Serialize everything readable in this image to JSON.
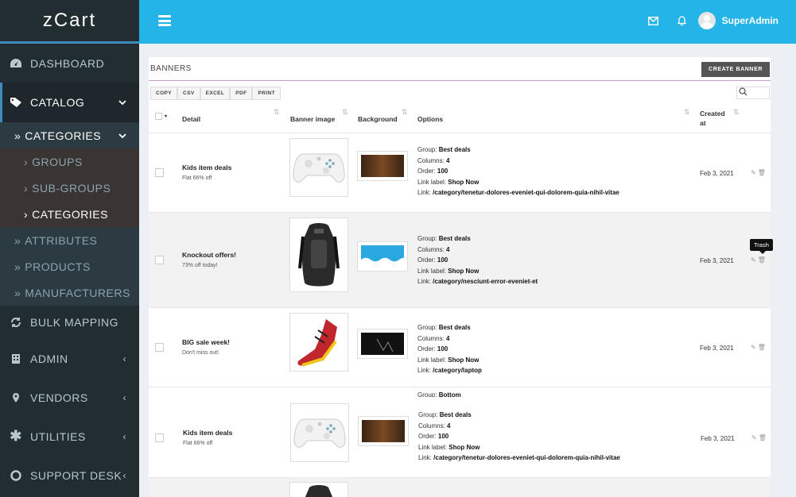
{
  "app": {
    "logo": "zCart"
  },
  "sidebar": {
    "items": [
      {
        "label": "DASHBOARD",
        "icon": "dashboard-icon"
      },
      {
        "label": "CATALOG",
        "icon": "tag-icon",
        "caret": "⌄"
      },
      {
        "label": "CATEGORIES",
        "caret": "⌄"
      },
      {
        "label": "GROUPS"
      },
      {
        "label": "SUB-GROUPS"
      },
      {
        "label": "CATEGORIES"
      },
      {
        "label": "ATTRIBUTES"
      },
      {
        "label": "PRODUCTS"
      },
      {
        "label": "MANUFACTURERS"
      },
      {
        "label": "BULK MAPPING",
        "icon": "refresh-icon"
      },
      {
        "label": "ADMIN",
        "icon": "building-icon",
        "caret": "‹"
      },
      {
        "label": "VENDORS",
        "icon": "map-pin-icon",
        "caret": "‹"
      },
      {
        "label": "UTILITIES",
        "icon": "asterisk-icon",
        "caret": "‹"
      },
      {
        "label": "SUPPORT DESK",
        "icon": "lifebuoy-icon",
        "caret": "‹"
      }
    ]
  },
  "header": {
    "user_name": "SuperAdmin"
  },
  "panel": {
    "title": "BANNERS",
    "create_label": "CREATE BANNER",
    "tools": [
      "COPY",
      "CSV",
      "EXCEL",
      "PDF",
      "PRINT"
    ],
    "columns": {
      "detail": "Detail",
      "banner_image": "Banner image",
      "background": "Background",
      "options": "Options",
      "created_1": "Created",
      "created_2": "at"
    }
  },
  "rows": [
    {
      "title": "Kids item deals",
      "subtitle": "Flat 66% off",
      "group": "Best deals",
      "columns": "4",
      "order": "100",
      "link_label": "Shop Now",
      "link": "/category/tenetur-dolores-eveniet-qui-dolorem-quia-nihil-vitae",
      "created": "Feb 3, 2021",
      "image": "controller",
      "bg": "#5a3a1e"
    },
    {
      "title": "Knockout offers!",
      "subtitle": "73% off today!",
      "group": "Best deals",
      "columns": "4",
      "order": "100",
      "link_label": "Shop Now",
      "link": "/category/nesciunt-error-eveniet-et",
      "created": "Feb 3, 2021",
      "image": "backpack",
      "bg": "#2aa9e0"
    },
    {
      "title": "BIG sale week!",
      "subtitle": "Don't miss out!",
      "group": "Best deals",
      "columns": "4",
      "order": "100",
      "link_label": "Shop Now",
      "link": "/category/laptop",
      "created": "Feb 3, 2021",
      "image": "shoe",
      "bg": "#111111"
    },
    {
      "title": "Kids item deals",
      "subtitle": "Flat 66% off",
      "group": "Best deals",
      "columns": "4",
      "order": "100",
      "link_label": "Shop Now",
      "link": "/category/tenetur-dolores-eveniet-qui-dolorem-quia-nihil-vitae",
      "created": "Feb 3, 2021",
      "image": "controller",
      "bg": "#5a3a1e"
    }
  ],
  "overlap_text": {
    "group_label": "Group:",
    "group_value": "Bottom"
  },
  "tooltip": "Trash",
  "labels": {
    "group": "Group:",
    "columns": "Columns:",
    "order": "Order:",
    "link_label": "Link label:",
    "link": "Link:"
  },
  "colors": {
    "header": "#24b4e8",
    "sidebar": "#222d32",
    "accent": "#3c8dbc"
  }
}
